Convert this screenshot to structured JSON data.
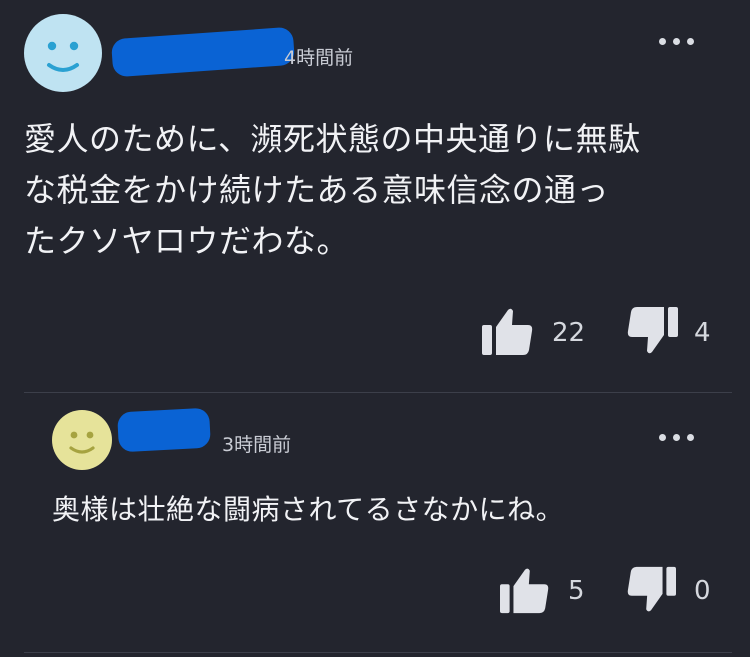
{
  "comments": [
    {
      "time": "4時間前",
      "text_lines": [
        "愛人のために、瀕死状態の中央通りに無駄",
        "な税金をかけ続けたある意味信念の通っ",
        "たクソヤロウだわな。"
      ],
      "likes": "22",
      "dislikes": "4",
      "avatar_color": "#bfe3f2"
    },
    {
      "time": "3時間前",
      "text_lines": [
        "奥様は壮絶な闘病されてるさなかにね。"
      ],
      "likes": "5",
      "dislikes": "0",
      "avatar_color": "#e6e39a"
    }
  ],
  "icons": {
    "more": "more-dots-icon",
    "like": "thumbs-up-icon",
    "dislike": "thumbs-down-icon"
  },
  "colors": {
    "background": "#23252e",
    "redaction": "#0a63d4"
  }
}
